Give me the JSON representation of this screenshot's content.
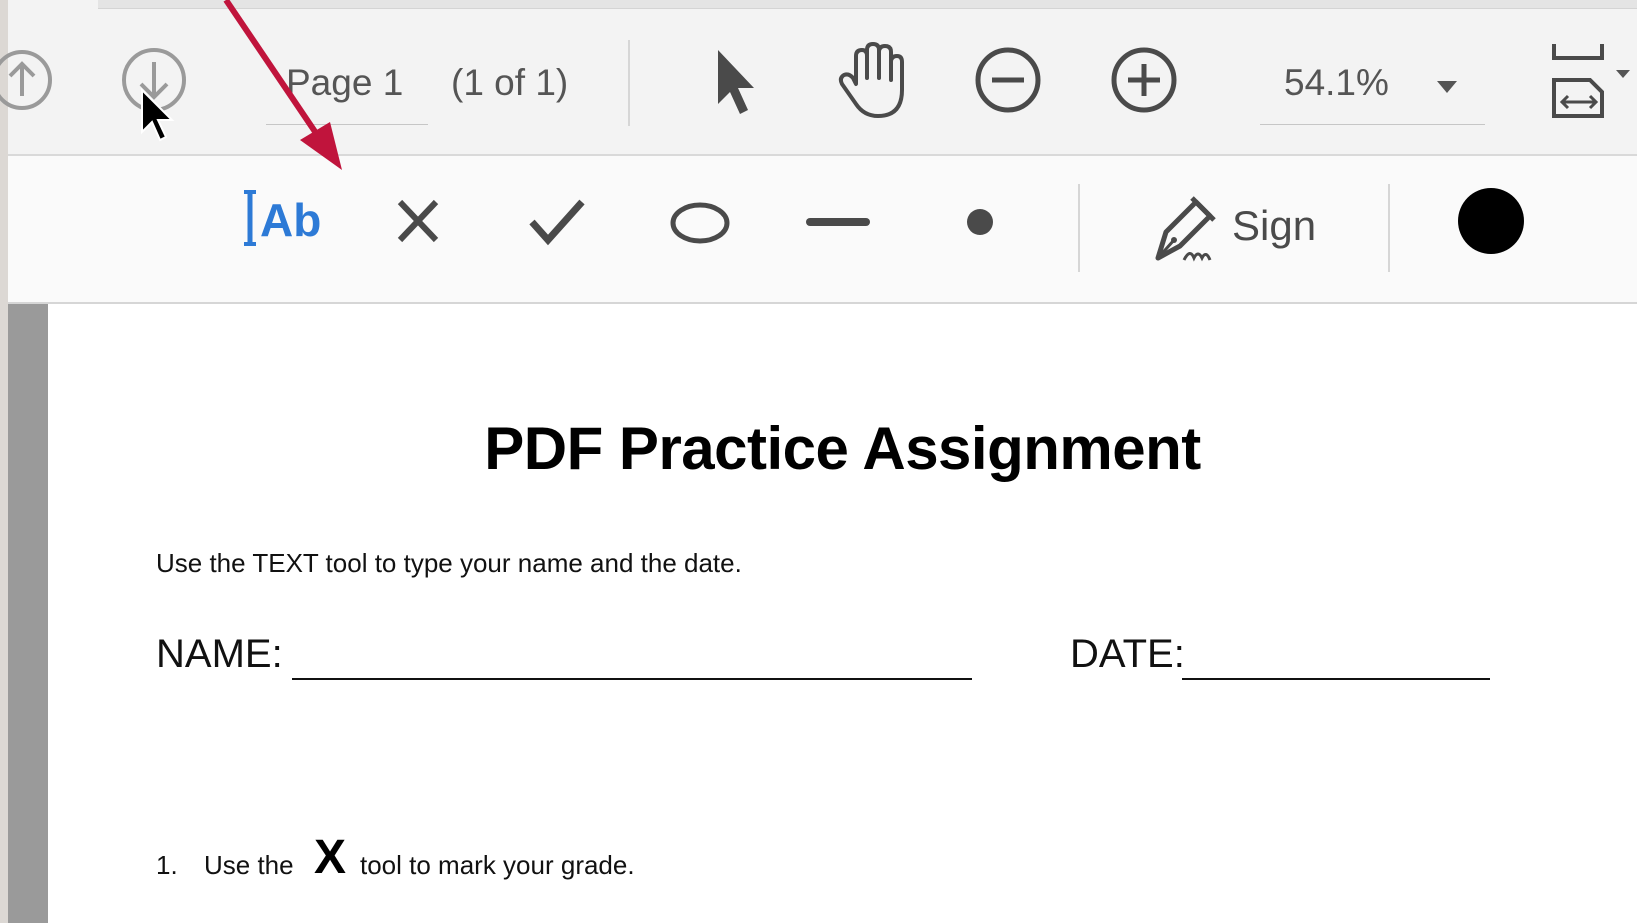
{
  "toolbar": {
    "page_input_value": "Page 1",
    "page_count": "(1 of 1)",
    "zoom_value": "54.1%"
  },
  "fill_sign_toolbar": {
    "sign_label": "Sign"
  },
  "document": {
    "title": "PDF Practice Assignment",
    "instruction": "Use the  TEXT tool to type your name and the date.",
    "name_label": "NAME:",
    "date_label": "DATE:",
    "question_1": {
      "number": "1.",
      "text_before": "Use the",
      "symbol": "X",
      "text_after": "tool to mark your grade."
    }
  },
  "colors": {
    "text_tool_accent": "#2d7ad6",
    "annotation_arrow": "#c0143c",
    "fill_color_dot": "#000000"
  },
  "icons": [
    "previous-page-icon",
    "next-page-icon",
    "select-tool-icon",
    "hand-tool-icon",
    "zoom-out-icon",
    "zoom-in-icon",
    "zoom-dropdown-icon",
    "fit-page-icon",
    "text-tool-icon",
    "cross-mark-icon",
    "check-mark-icon",
    "ellipse-icon",
    "line-icon",
    "dot-icon",
    "sign-pen-icon",
    "color-dot-icon",
    "mouse-cursor-icon"
  ]
}
